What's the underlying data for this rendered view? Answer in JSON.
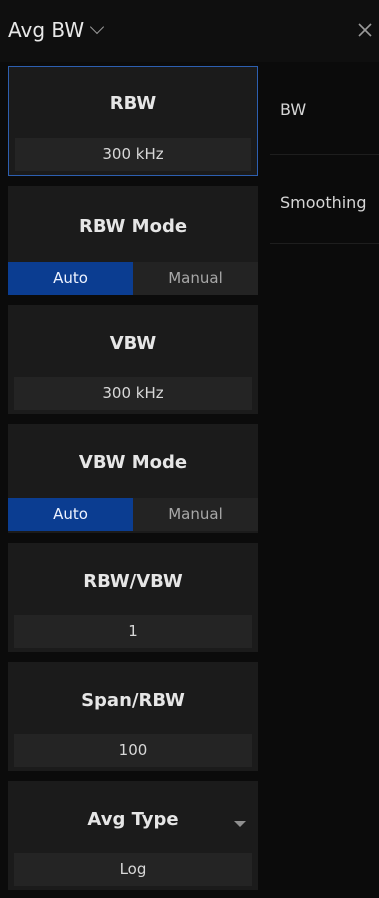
{
  "header": {
    "title": "Avg BW",
    "dropdown_icon": "chevron-down-icon",
    "close_icon": "close-icon"
  },
  "settings": {
    "rbw": {
      "label": "RBW",
      "value": "300 kHz"
    },
    "rbw_mode": {
      "label": "RBW Mode",
      "options": [
        "Auto",
        "Manual"
      ],
      "selected": "Auto"
    },
    "vbw": {
      "label": "VBW",
      "value": "300 kHz"
    },
    "vbw_mode": {
      "label": "VBW Mode",
      "options": [
        "Auto",
        "Manual"
      ],
      "selected": "Auto"
    },
    "rbw_vbw": {
      "label": "RBW/VBW",
      "value": "1"
    },
    "span_rbw": {
      "label": "Span/RBW",
      "value": "100"
    },
    "avg_type": {
      "label": "Avg Type",
      "value": "Log"
    }
  },
  "right_menu": {
    "items": [
      "BW",
      "Smoothing"
    ]
  },
  "colors": {
    "background": "#0b0b0b",
    "panel": "#1b1b1b",
    "active_segment": "#0b3d91",
    "selected_border": "#2d5fb0"
  }
}
